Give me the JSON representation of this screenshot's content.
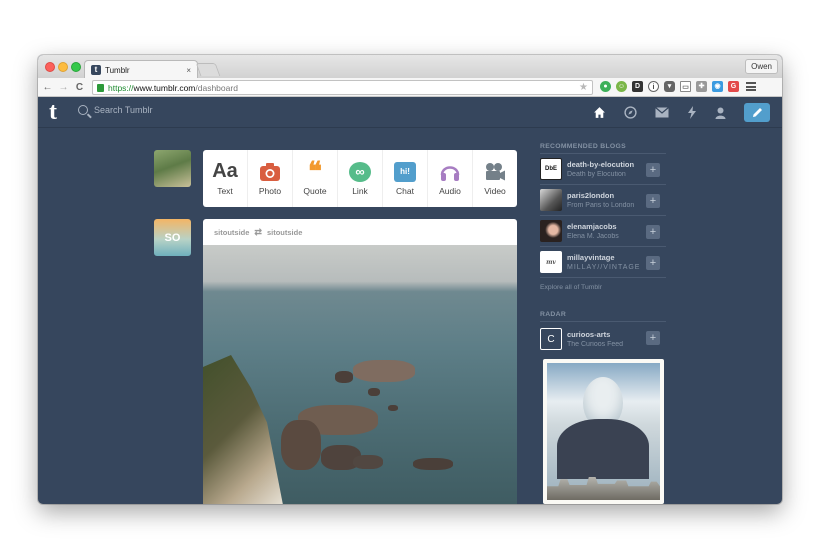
{
  "browser": {
    "tab_title": "Tumblr",
    "tab_close": "×",
    "profile_name": "Owen",
    "url_scheme": "https://",
    "url_host": "www.tumblr.com",
    "url_path": "/dashboard",
    "nav": {
      "back": "←",
      "forward": "→",
      "reload": "C"
    }
  },
  "header": {
    "logo": "t",
    "search_placeholder": "Search Tumblr",
    "icons": [
      "home-icon",
      "compass-icon",
      "mail-icon",
      "lightning-icon",
      "user-icon",
      "pencil-icon"
    ]
  },
  "post_form": {
    "items": [
      {
        "label": "Text",
        "glyph": "Aa",
        "color": "#444444"
      },
      {
        "label": "Photo",
        "glyph": "",
        "color": "#d95e40"
      },
      {
        "label": "Quote",
        "glyph": "❝",
        "color": "#f2992e"
      },
      {
        "label": "Link",
        "glyph": "∞",
        "color": "#56bc8a"
      },
      {
        "label": "Chat",
        "glyph": "hi!",
        "color": "#529ecc"
      },
      {
        "label": "Audio",
        "glyph": "♫",
        "color": "#a77dc2"
      },
      {
        "label": "Video",
        "glyph": "▶",
        "color": "#748089"
      }
    ]
  },
  "post": {
    "author": "sitoutside",
    "reblog_symbol": "⇄",
    "reblogged_from": "sitoutside",
    "poster_avatar_text": "SO"
  },
  "sidebar": {
    "recommended_heading": "RECOMMENDED BLOGS",
    "blogs": [
      {
        "name": "death-by-elocution",
        "title": "Death by Elocution",
        "avatar_text": "DbE"
      },
      {
        "name": "paris2london",
        "title": "From Paris to London",
        "avatar_text": ""
      },
      {
        "name": "elenamjacobs",
        "title": "Elena M. Jacobs",
        "avatar_text": ""
      },
      {
        "name": "millayvintage",
        "title": "MILLAY//VINTAGE",
        "avatar_text": "mv"
      }
    ],
    "follow_symbol": "+",
    "explore_link": "Explore all of Tumblr",
    "radar_heading": "RADAR",
    "radar_blog": {
      "name": "curioos-arts",
      "title": "The Curioos Feed",
      "avatar_text": "C"
    }
  },
  "colors": {
    "dashboard_bg": "#36465d",
    "accent_blue": "#529ecc"
  }
}
